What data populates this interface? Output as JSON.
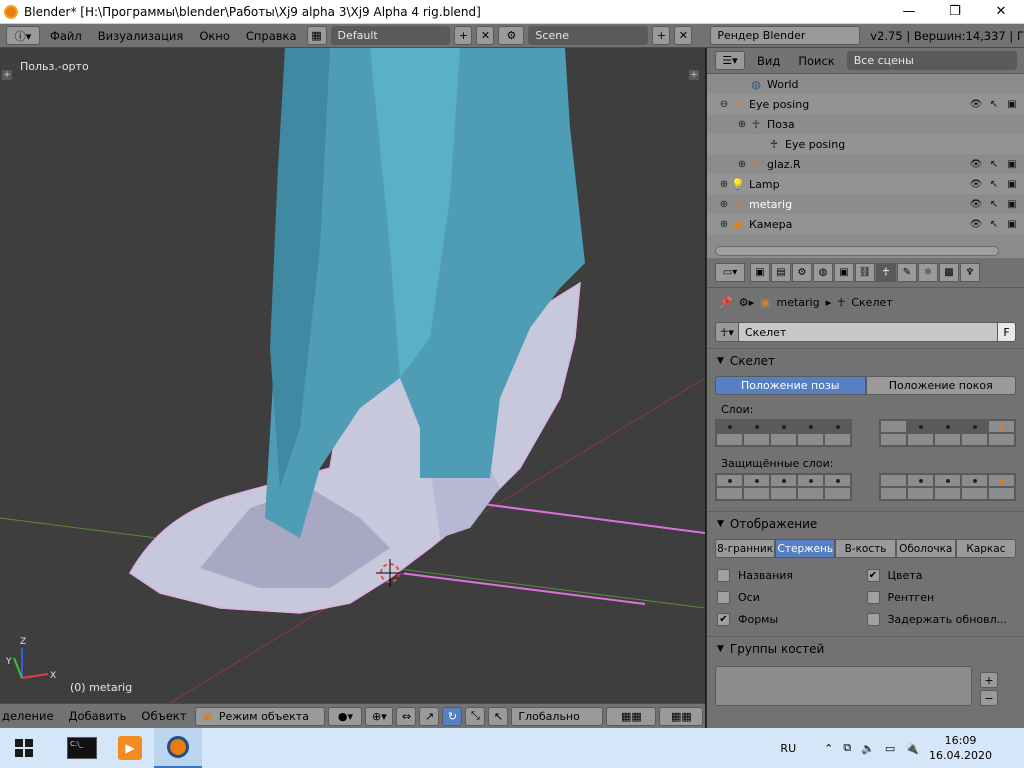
{
  "window": {
    "title": "Blender* [H:\\Программы\\blender\\Работы\\Xj9 alpha 3\\Xj9 Alpha 4 rig.blend]",
    "minimize": "—",
    "maximize": "❐",
    "close": "✕"
  },
  "info_header": {
    "menu": [
      "Файл",
      "Визуализация",
      "Окно",
      "Справка"
    ],
    "layout": "Default",
    "scene": "Scene",
    "engine": "Рендер Blender",
    "version": "v2.75 | Вершин:14,337 | Г"
  },
  "viewport": {
    "view_label": "Польз.-орто",
    "active_object": "(0) metarig",
    "axis_x": "X",
    "axis_y": "Y",
    "axis_z": "Z"
  },
  "viewport_header": {
    "select_menu": "деление",
    "add_menu": "Добавить",
    "object_menu": "Объект",
    "mode": "Режим объекта",
    "orientation": "Глобально"
  },
  "outliner": {
    "view_menu": "Вид",
    "search_menu": "Поиск",
    "filter": "Все сцены",
    "rows": [
      {
        "label": "World",
        "icon": "world-icon",
        "indent": 1,
        "expander": ""
      },
      {
        "label": "Eye posing",
        "icon": "armature-icon",
        "indent": 0,
        "expander": "⊖"
      },
      {
        "label": "Поза",
        "icon": "pose-icon",
        "indent": 1,
        "expander": "⊕"
      },
      {
        "label": "Eye posing",
        "icon": "armature-data-icon",
        "indent": 2,
        "expander": ""
      },
      {
        "label": "glaz.R",
        "icon": "mesh-icon",
        "indent": 1,
        "expander": "⊕"
      },
      {
        "label": "Lamp",
        "icon": "lamp-icon",
        "indent": 0,
        "expander": "⊕"
      },
      {
        "label": "metarig",
        "icon": "armature-icon",
        "indent": 0,
        "expander": "⊕"
      },
      {
        "label": "Камера",
        "icon": "camera-icon",
        "indent": 0,
        "expander": "⊕"
      }
    ]
  },
  "properties": {
    "breadcrumb": [
      "metarig",
      "Скелет"
    ],
    "data_name": "Скелет",
    "fake_user": "F",
    "skeleton_panel": {
      "title": "Скелет",
      "pose_position": "Положение позы",
      "rest_position": "Положение покоя",
      "layers_label": "Слои:",
      "protected_label": "Защищённые слои:"
    },
    "display_panel": {
      "title": "Отображение",
      "modes": [
        "8-гранник",
        "Стержень",
        "В-кость",
        "Оболочка",
        "Каркас"
      ],
      "active_mode": "Стержень",
      "checks": [
        {
          "label": "Названия",
          "checked": false
        },
        {
          "label": "Цвета",
          "checked": true
        },
        {
          "label": "Оси",
          "checked": false
        },
        {
          "label": "Рентген",
          "checked": false
        },
        {
          "label": "Формы",
          "checked": true
        },
        {
          "label": "Задержать обновл...",
          "checked": false
        }
      ]
    },
    "bone_groups_panel": {
      "title": "Группы костей",
      "add": "+",
      "remove": "−"
    }
  },
  "taskbar": {
    "lang": "RU",
    "time": "16:09",
    "date": "16.04.2020"
  }
}
